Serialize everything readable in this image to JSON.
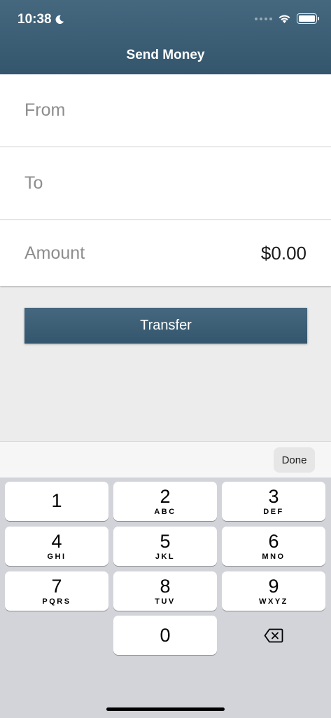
{
  "status_bar": {
    "time": "10:38",
    "icons": [
      "moon-icon",
      "signal-icon",
      "wifi-icon",
      "battery-icon"
    ]
  },
  "header": {
    "title": "Send Money"
  },
  "form": {
    "from_label": "From",
    "to_label": "To",
    "amount_label": "Amount",
    "amount_value": "$0.00"
  },
  "transfer_button": {
    "label": "Transfer"
  },
  "keyboard": {
    "done_label": "Done",
    "keys": [
      {
        "digit": "1",
        "letters": ""
      },
      {
        "digit": "2",
        "letters": "ABC"
      },
      {
        "digit": "3",
        "letters": "DEF"
      },
      {
        "digit": "4",
        "letters": "GHI"
      },
      {
        "digit": "5",
        "letters": "JKL"
      },
      {
        "digit": "6",
        "letters": "MNO"
      },
      {
        "digit": "7",
        "letters": "PQRS"
      },
      {
        "digit": "8",
        "letters": "TUV"
      },
      {
        "digit": "9",
        "letters": "WXYZ"
      },
      {
        "digit": "0",
        "letters": ""
      }
    ],
    "backspace_icon": "backspace-icon"
  },
  "colors": {
    "header": "#3d5f76",
    "button": "#3d5f76",
    "keyboard_bg": "#d2d4da"
  }
}
